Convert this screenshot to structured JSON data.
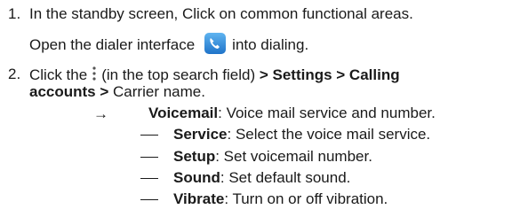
{
  "step1": {
    "number": "1.",
    "line1": "In the standby screen, Click on common functional areas.",
    "line2_before": "Open the dialer interface",
    "line2_after": "into dialing.",
    "icon": "phone-dialer-icon"
  },
  "step2": {
    "number": "2.",
    "click": "Click the",
    "icon": "more-options-icon",
    "paren": "(in the top search field)",
    "path1": "> Settings > Calling",
    "path2": "accounts >",
    "tail": "Carrier name."
  },
  "voicemail": {
    "arrow": "→",
    "title": "Voicemail",
    "desc": ": Voice mail service and number.",
    "items": [
      {
        "term": "Service",
        "desc": ": Select the voice mail service."
      },
      {
        "term": "Setup",
        "desc": ": Set voicemail number."
      },
      {
        "term": "Sound",
        "desc": ": Set default sound."
      },
      {
        "term": "Vibrate",
        "desc": ": Turn on or off vibration."
      }
    ]
  }
}
